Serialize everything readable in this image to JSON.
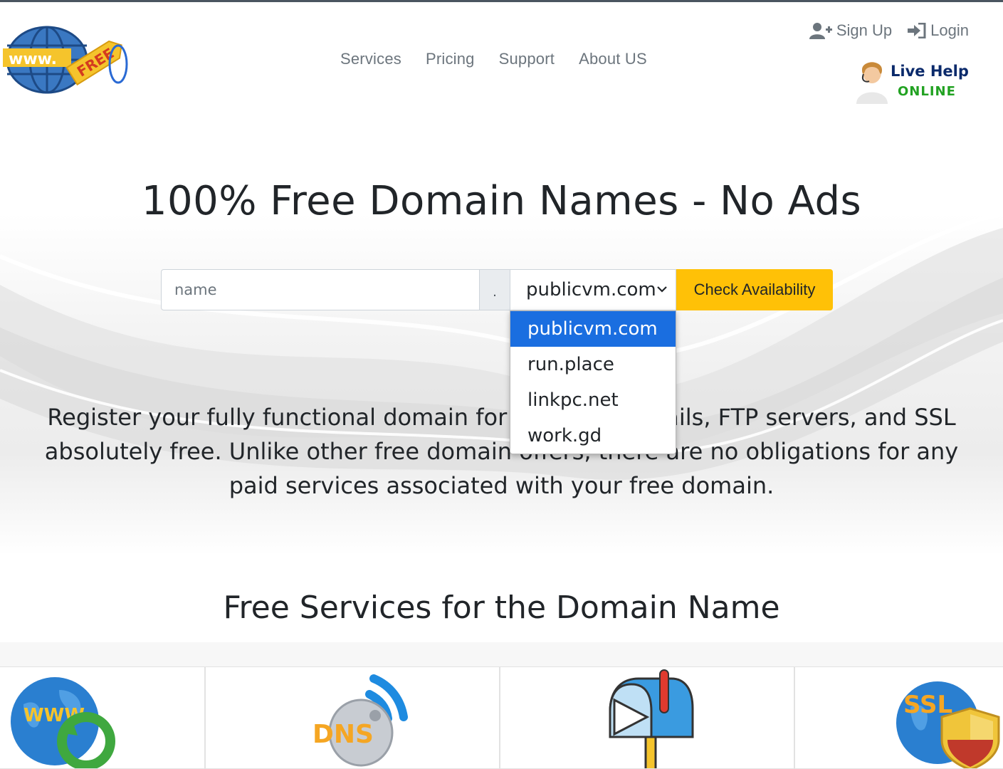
{
  "header": {
    "logo": {
      "www": "www.",
      "free": "FREE"
    },
    "nav": [
      "Services",
      "Pricing",
      "Support",
      "About US"
    ],
    "sign_up": "Sign Up",
    "login": "Login",
    "live_help": {
      "line1": "Live Help",
      "line2": "ONLINE"
    }
  },
  "hero": {
    "title": "100% Free Domain Names - No Ads",
    "search": {
      "placeholder": "name",
      "separator": ".",
      "selected_tld": "publicvm.com",
      "button": "Check Availability",
      "options": [
        "publicvm.com",
        "run.place",
        "linkpc.net",
        "work.gd"
      ]
    },
    "description": "Register your fully functional domain for websites, emails, FTP servers, and SSL absolutely free. Unlike other free domain offers, there are no obligations for any paid services associated with your free domain."
  },
  "services": {
    "title": "Free Services for the Domain Name",
    "cards": [
      {
        "icon": "www-globe-icon",
        "label": "WWW"
      },
      {
        "icon": "dns-satellite-icon",
        "label": "DNS"
      },
      {
        "icon": "mailbox-icon",
        "label": ""
      },
      {
        "icon": "ssl-shield-icon",
        "label": "SSL"
      }
    ]
  },
  "colors": {
    "accent": "#ffc107",
    "selected": "#1a6ee0",
    "nav": "#6c757d"
  }
}
